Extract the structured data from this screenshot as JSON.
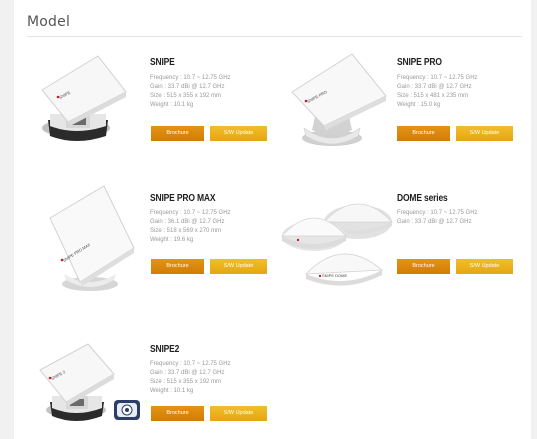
{
  "section": {
    "title": "Model"
  },
  "products": [
    {
      "name": "SNIPE",
      "specs": [
        "Frequency : 10.7 ~ 12.75 GHz",
        "Gain : 33.7 dBi @ 12.7 GHz",
        "Size : 515 x 355 x 192 mm",
        "Weight : 10.1 kg"
      ],
      "brochure": "Brochure",
      "update": "S/W Update",
      "dish_label": "SNIPE"
    },
    {
      "name": "SNIPE PRO",
      "specs": [
        "Frequency : 10.7 ~ 12.75 GHz",
        "Gain : 33.7 dBi @ 12.7 GHz",
        "Size : 515 x 481 x 235 mm",
        "Weight : 15.0 kg"
      ],
      "brochure": "Brochure",
      "update": "S/W Update",
      "dish_label": "SNIPE PRO"
    },
    {
      "name": "SNIPE PRO MAX",
      "specs": [
        "Frequency : 10.7 ~ 12.75 GHz",
        "Gain : 36.1 dBi @ 12.7 GHz",
        "Size : 518 x 569 x 270 mm",
        "Weight : 19.6 kg"
      ],
      "brochure": "Brochure",
      "update": "S/W Update",
      "dish_label": "SNIPE PRO MAX"
    },
    {
      "name": "DOME series",
      "specs": [
        "Frequency : 10.7 ~ 12.75 GHz",
        "Gain : 33.7 dBi @ 12.7 GHz"
      ],
      "brochure": "Brochure",
      "update": "S/W Update",
      "dish_label": "SNIPE DOME"
    },
    {
      "name": "SNIPE2",
      "specs": [
        "Frequency : 10.7 ~ 12.75 GHz",
        "Gain : 33.7 dBi @ 12.7 GHz",
        "Size : 515 x 355 x 192 mm",
        "Weight : 10.1 kg"
      ],
      "brochure": "Brochure",
      "update": "S/W Update",
      "dish_label": "SNIPE 2"
    }
  ],
  "colors": {
    "brochure": "#d88407",
    "update": "#eab01c",
    "accent_red": "#c8202a"
  }
}
